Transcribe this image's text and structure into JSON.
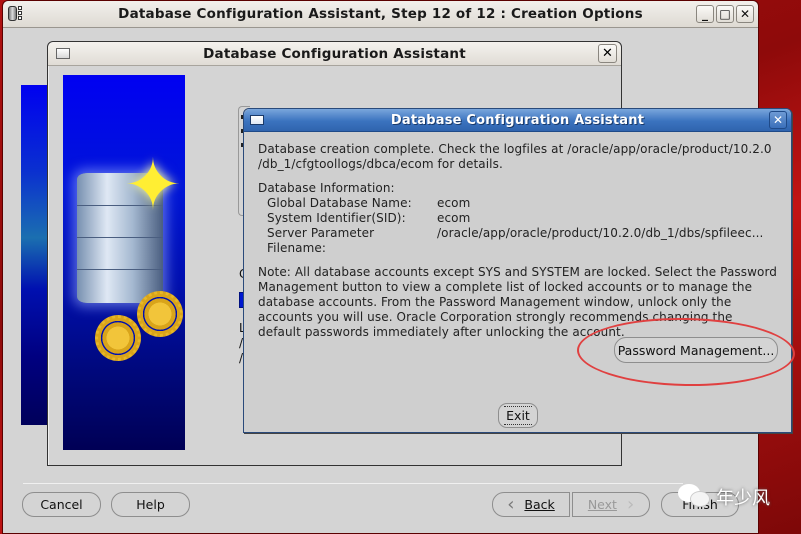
{
  "main_window": {
    "title": "Database Configuration Assistant, Step 12 of 12 : Creation Options",
    "app_icon": "database-app-icon",
    "wm_buttons": {
      "minimize": "_",
      "maximize": "□",
      "close": "✕"
    }
  },
  "inner_dialog": {
    "title": "Database Configuration Assistant",
    "close": "✕",
    "clipped_text": {
      "c": "C",
      "l": "L",
      "s1": "/",
      "s2": "/"
    }
  },
  "footer": {
    "cancel": "Cancel",
    "help": "Help",
    "back": "Back",
    "back_icon": "‹",
    "next": "Next",
    "next_icon": "›",
    "finish": "Finish"
  },
  "alert": {
    "title": "Database Configuration Assistant",
    "close": "✕",
    "message": "Database creation complete. Check the logfiles at /oracle/app/oracle/product/10.2.0 /db_1/cfgtoollogs/dbca/ecom for details.",
    "info_heading": "Database Information:",
    "info": [
      {
        "label": "Global Database Name:",
        "value": "ecom"
      },
      {
        "label": "System Identifier(SID):",
        "value": "ecom"
      },
      {
        "label": "Server Parameter Filename:",
        "value": "/oracle/app/oracle/product/10.2.0/db_1/dbs/spfileec..."
      }
    ],
    "note": "Note: All database accounts except SYS and SYSTEM are locked. Select the Password Management button to view a complete list of locked accounts or to manage the database accounts. From the Password Management window, unlock only the accounts you will use. Oracle Corporation strongly recommends changing the default passwords immediately after unlocking the account.",
    "password_button": "Password Management...",
    "exit_button": "Exit"
  },
  "watermark": {
    "text": "年少风",
    "icon": "wechat-icon"
  },
  "colors": {
    "annotation": "#e04040",
    "alert_title_bg": "#3b73bf",
    "desktop_bg": "#b01010"
  }
}
